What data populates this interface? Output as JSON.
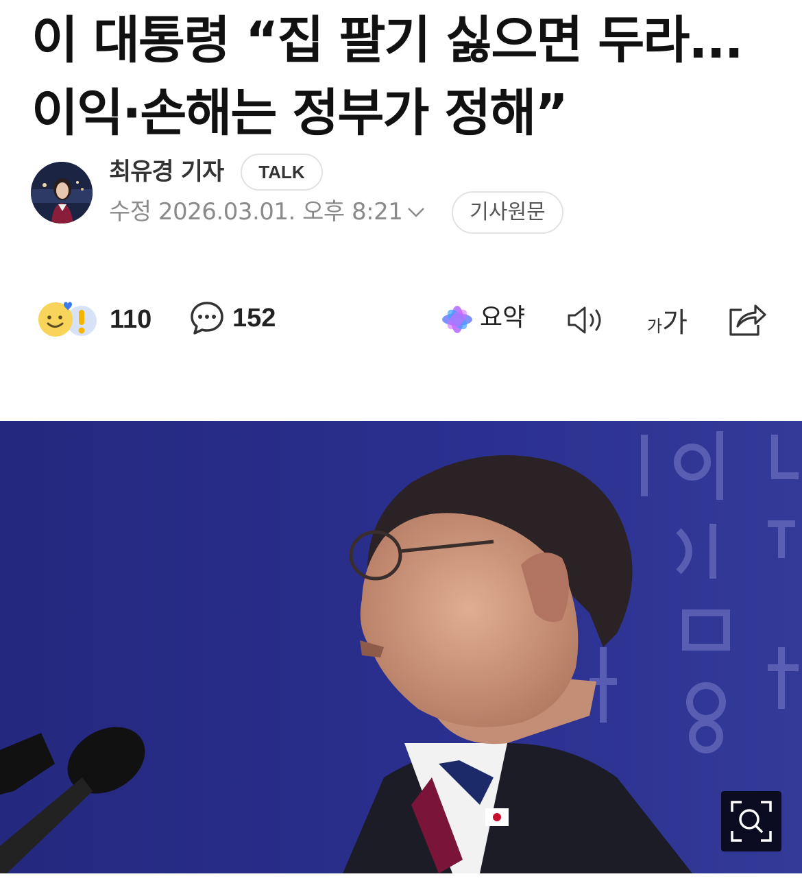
{
  "article": {
    "headline_line1": "이 대통령 “집 팔기 싫으면 두라...",
    "headline_line2": "이익·손해는 정부가 정해”"
  },
  "reporter": {
    "name": "최유경 기자",
    "talk_label": "TALK"
  },
  "meta": {
    "date": "수정 2026.03.01. 오후 8:21",
    "source_label": "기사원문"
  },
  "toolbar": {
    "reaction_count": "110",
    "comment_count": "152",
    "summary_label": "요약",
    "font_small": "가",
    "font_big": "가"
  },
  "icons": [
    "reaction-emoji-icon",
    "comment-icon",
    "ai-summary-icon",
    "speaker-icon",
    "font-size-icon",
    "share-icon",
    "zoom-icon",
    "chevron-down-icon"
  ],
  "colors": {
    "headline": "#111111",
    "meta": "#8a8a8a",
    "photo_background": "#2a2f88"
  }
}
